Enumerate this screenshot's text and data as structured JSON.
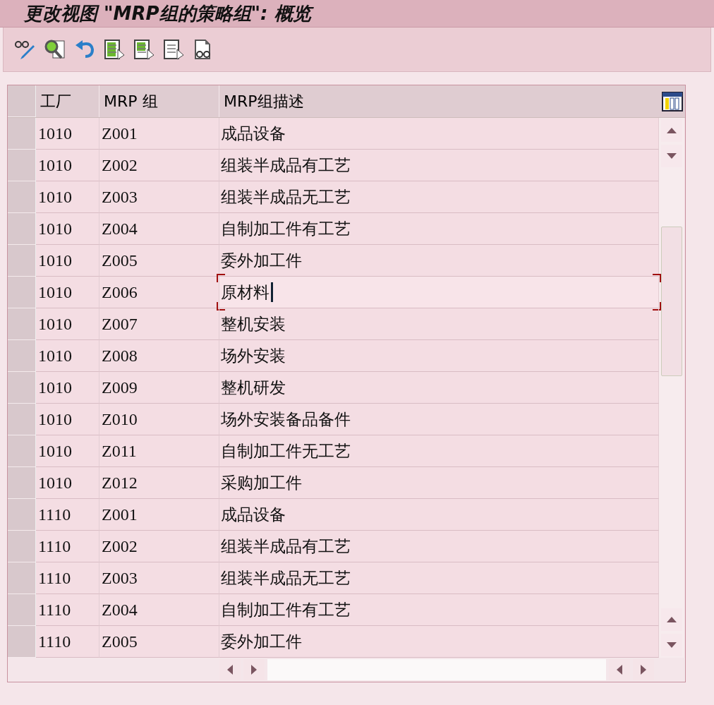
{
  "window": {
    "title": "更改视图 \"MRP组的策略组\": 概览"
  },
  "toolbar": {
    "buttons": [
      {
        "kind": "edit"
      },
      {
        "kind": "find"
      },
      {
        "kind": "undo"
      },
      {
        "kind": "select-all"
      },
      {
        "kind": "select-block"
      },
      {
        "kind": "deselect"
      },
      {
        "kind": "view"
      }
    ]
  },
  "table": {
    "columns": [
      "工厂",
      "MRP 组",
      "MRP组描述"
    ],
    "rows": [
      {
        "plant": "1010",
        "group": "Z001",
        "description": "成品设备",
        "focused": false
      },
      {
        "plant": "1010",
        "group": "Z002",
        "description": "组装半成品有工艺",
        "focused": false
      },
      {
        "plant": "1010",
        "group": "Z003",
        "description": "组装半成品无工艺",
        "focused": false
      },
      {
        "plant": "1010",
        "group": "Z004",
        "description": "自制加工件有工艺",
        "focused": false
      },
      {
        "plant": "1010",
        "group": "Z005",
        "description": "委外加工件",
        "focused": false
      },
      {
        "plant": "1010",
        "group": "Z006",
        "description": "原材料",
        "focused": true
      },
      {
        "plant": "1010",
        "group": "Z007",
        "description": "整机安装",
        "focused": false
      },
      {
        "plant": "1010",
        "group": "Z008",
        "description": "场外安装",
        "focused": false
      },
      {
        "plant": "1010",
        "group": "Z009",
        "description": "整机研发",
        "focused": false
      },
      {
        "plant": "1010",
        "group": "Z010",
        "description": "场外安装备品备件",
        "focused": false
      },
      {
        "plant": "1010",
        "group": "Z011",
        "description": "自制加工件无工艺",
        "focused": false
      },
      {
        "plant": "1010",
        "group": "Z012",
        "description": "采购加工件",
        "focused": false
      },
      {
        "plant": "1110",
        "group": "Z001",
        "description": "成品设备",
        "focused": false
      },
      {
        "plant": "1110",
        "group": "Z002",
        "description": "组装半成品有工艺",
        "focused": false
      },
      {
        "plant": "1110",
        "group": "Z003",
        "description": "组装半成品无工艺",
        "focused": false
      },
      {
        "plant": "1110",
        "group": "Z004",
        "description": "自制加工件有工艺",
        "focused": false
      },
      {
        "plant": "1110",
        "group": "Z005",
        "description": "委外加工件",
        "focused": false
      }
    ]
  }
}
